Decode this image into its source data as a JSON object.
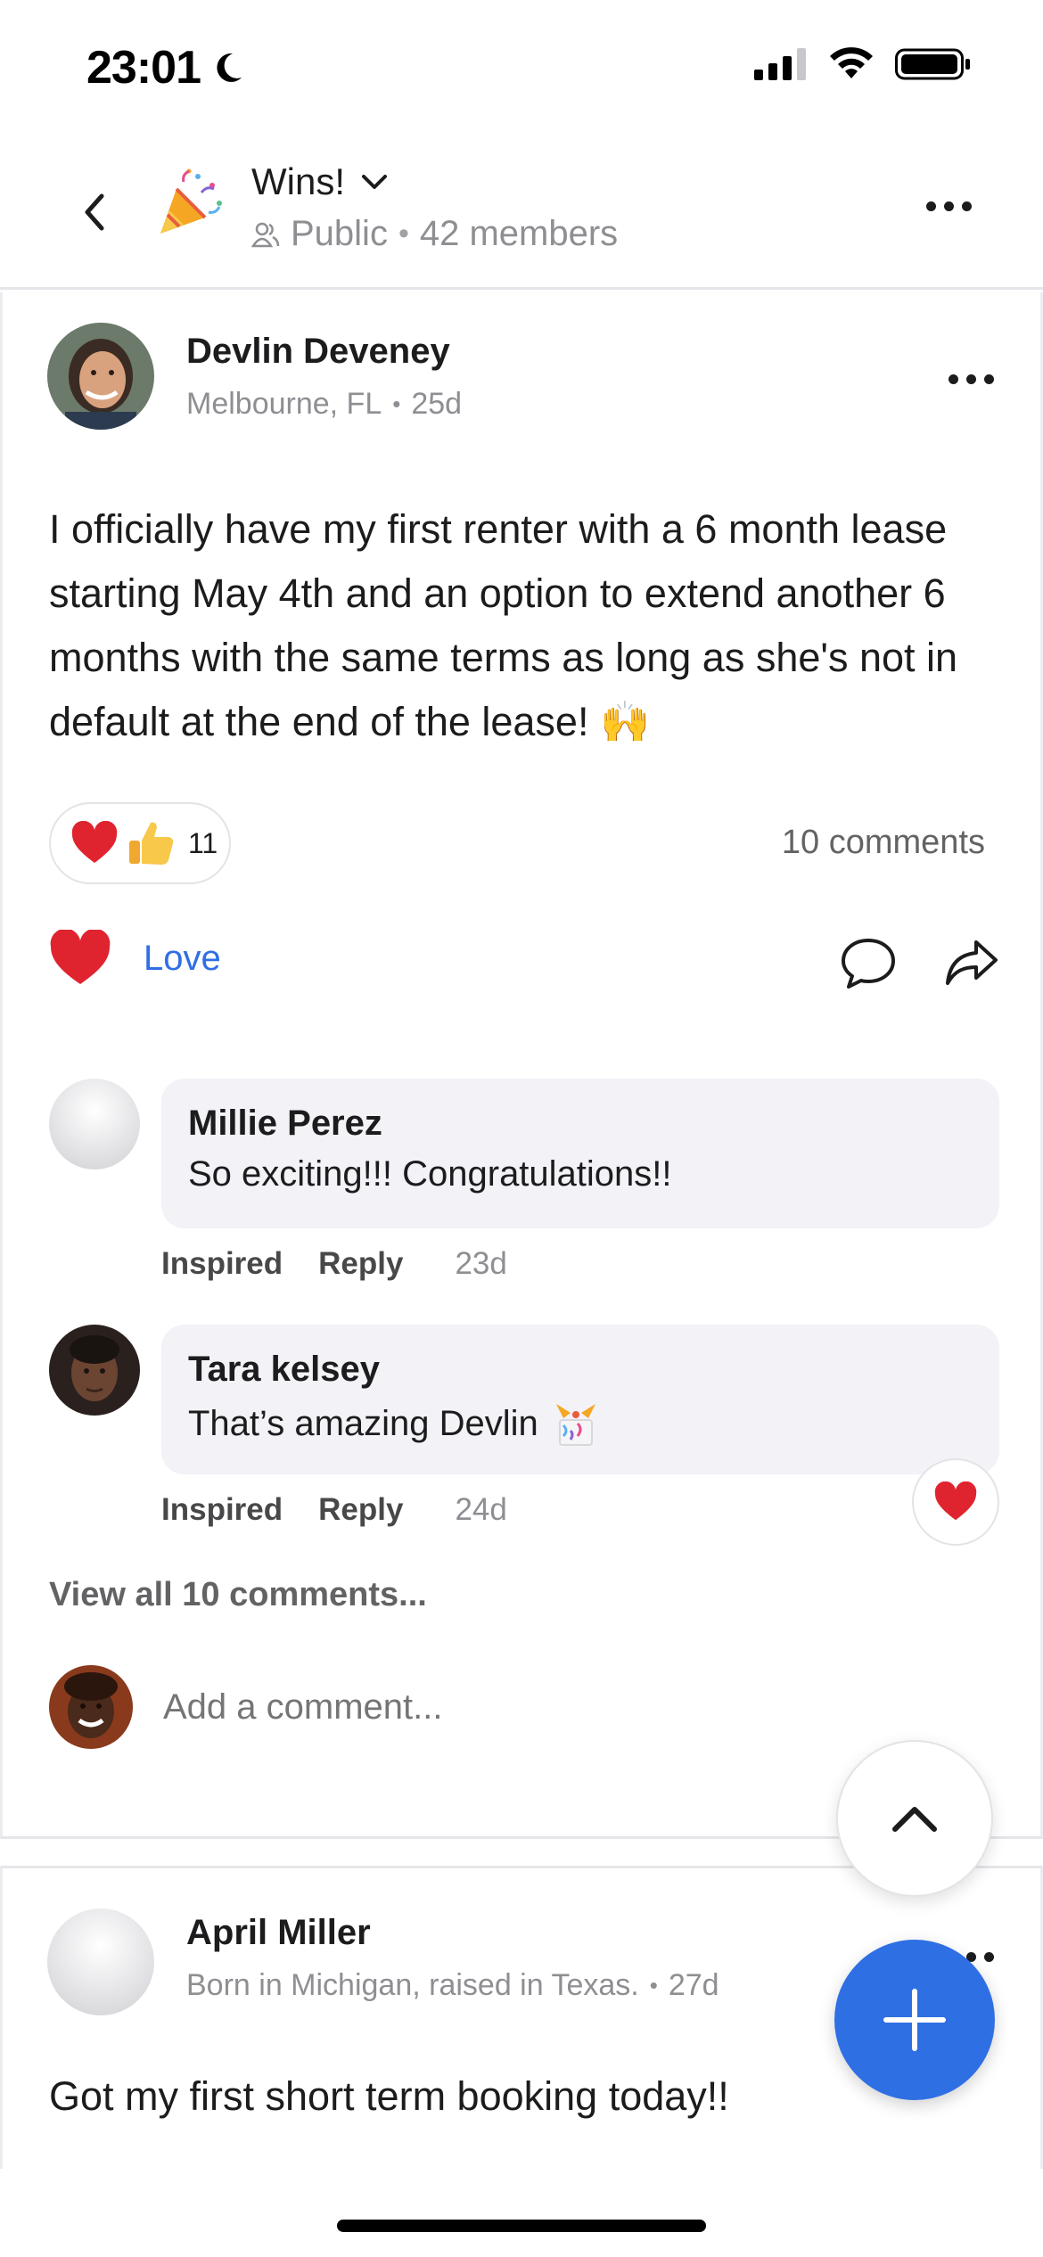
{
  "status_bar": {
    "time": "23:01"
  },
  "header": {
    "group_name": "Wins!",
    "visibility": "Public",
    "separator": "•",
    "members": "42 members"
  },
  "post": {
    "author": "Devlin Deveney",
    "location": "Melbourne, FL",
    "separator": "•",
    "age": "25d",
    "body": "I officially have my first renter with a 6 month lease starting May 4th and an option to extend another 6 months with the same terms as long as she's not in default at the end of the lease! 🙌",
    "reaction_count": "11",
    "comments_count": "10 comments",
    "love_label": "Love",
    "comments": [
      {
        "name": "Millie Perez",
        "text": "So exciting!!!  Congratulations!!",
        "inspired": "Inspired",
        "reply": "Reply",
        "time": "23d"
      },
      {
        "name": "Tara kelsey",
        "text": "That’s amazing Devlin",
        "inspired": "Inspired",
        "reply": "Reply",
        "time": "24d"
      }
    ],
    "view_all": "View all 10 comments...",
    "add_comment_placeholder": "Add a comment..."
  },
  "post2": {
    "author": "April Miller",
    "bio": "Born in Michigan, raised in Texas.",
    "separator": "•",
    "age": "27d",
    "body": "Got my first short term booking today!!"
  },
  "colors": {
    "accent": "#2f6fe4",
    "love": "#e0242f",
    "muted": "#8e8e93"
  },
  "icons": [
    "back-chevron",
    "party-popper",
    "people",
    "more-dots",
    "heart",
    "comment-bubble",
    "share-arrow",
    "chevron-up",
    "plus"
  ]
}
